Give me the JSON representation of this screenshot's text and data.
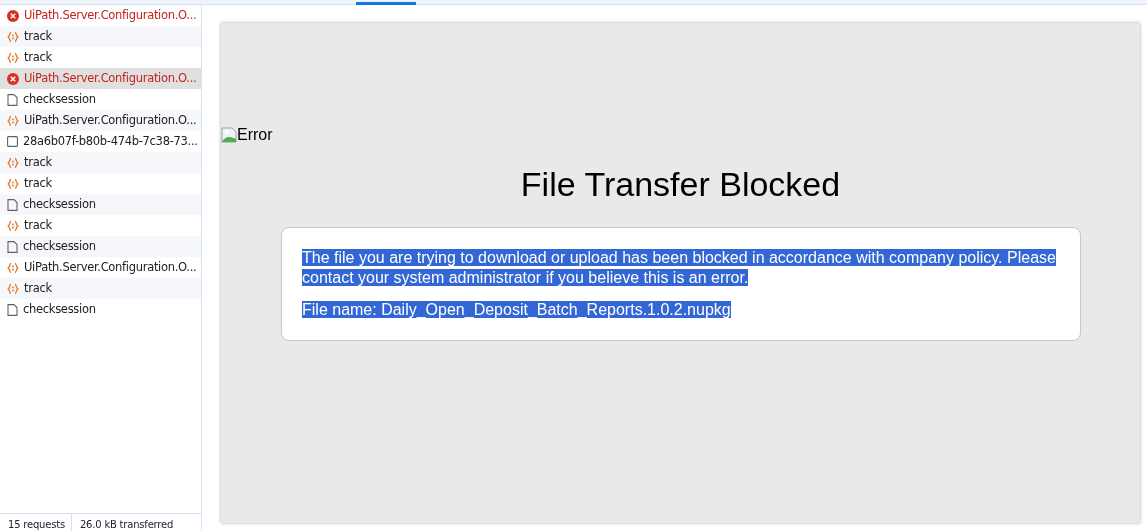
{
  "requests": [
    {
      "name": "UiPath.Server.Configuration.O...",
      "kind": "error",
      "selected": false
    },
    {
      "name": "track",
      "kind": "script",
      "selected": false
    },
    {
      "name": "track",
      "kind": "script",
      "selected": false
    },
    {
      "name": "UiPath.Server.Configuration.O...",
      "kind": "error",
      "selected": true
    },
    {
      "name": "checksession",
      "kind": "document",
      "selected": false
    },
    {
      "name": "UiPath.Server.Configuration.O...",
      "kind": "script",
      "selected": false
    },
    {
      "name": "28a6b07f-b80b-474b-7c38-73...",
      "kind": "other",
      "selected": false
    },
    {
      "name": "track",
      "kind": "script",
      "selected": false
    },
    {
      "name": "track",
      "kind": "script",
      "selected": false
    },
    {
      "name": "checksession",
      "kind": "document",
      "selected": false
    },
    {
      "name": "track",
      "kind": "script",
      "selected": false
    },
    {
      "name": "checksession",
      "kind": "document",
      "selected": false
    },
    {
      "name": "UiPath.Server.Configuration.O...",
      "kind": "script",
      "selected": false
    },
    {
      "name": "track",
      "kind": "script",
      "selected": false
    },
    {
      "name": "checksession",
      "kind": "document",
      "selected": false
    }
  ],
  "status_bar": [
    "15 requests",
    "26.0 kB transferred"
  ],
  "preview": {
    "image_alt": "Error",
    "title": "File Transfer Blocked",
    "message": "The file you are trying to download or upload has been blocked in accordance with company policy. Please contact your system administrator if you believe this is an error.",
    "file_line": "File name: Daily_Open_Deposit_Batch_Reports.1.0.2.nupkg",
    "text_selected": true
  }
}
